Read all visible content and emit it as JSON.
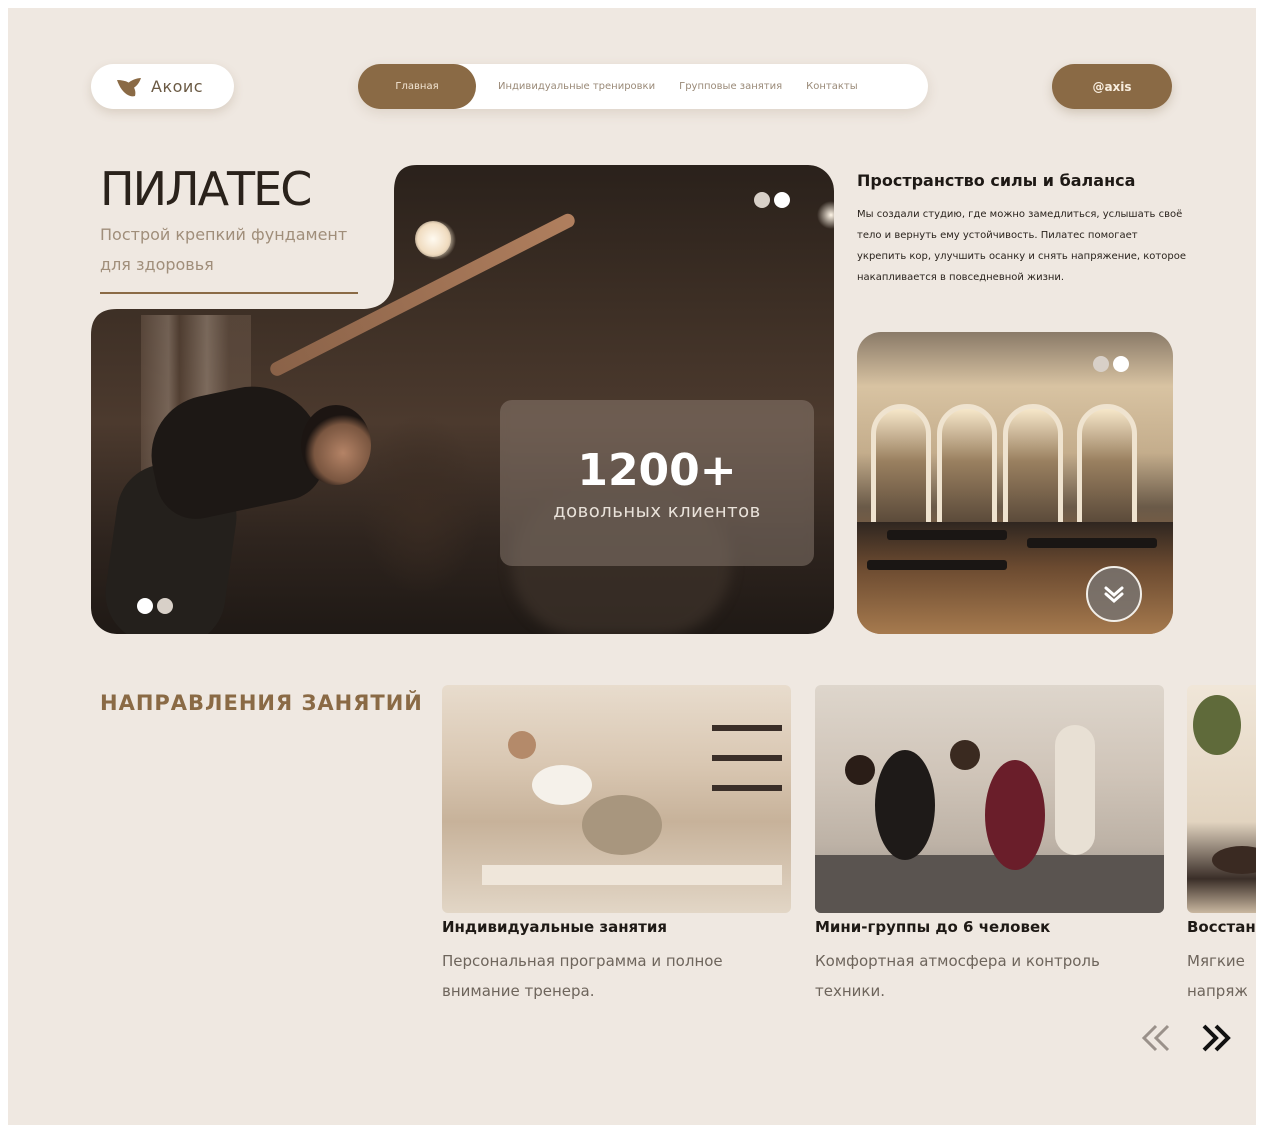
{
  "header": {
    "logo_text": "Акоис",
    "nav": [
      "Главная",
      "Индивидуальные тренировки",
      "Групповые занятия",
      "Контакты"
    ],
    "social_button": "@axis"
  },
  "hero": {
    "title": "ПИЛАТЕС",
    "subtitle": "Построй крепкий фундамент для здоровья",
    "stats_number": "1200+",
    "stats_label": "довольных клиентов"
  },
  "about": {
    "title": "Пространство силы и баланса",
    "text": "Мы создали студию, где можно замедлиться, услышать своё тело и вернуть ему устойчивость. Пилатес помогает укрепить кор, улучшить осанку и снять напряжение, которое накапливается в повседневной жизни."
  },
  "directions": {
    "title": "НАПРАВЛЕНИЯ ЗАНЯТИЙ",
    "cards": [
      {
        "title": "Индивидуальные занятия",
        "text": "Персональная программа и полное внимание тренера."
      },
      {
        "title": "Мини-группы до 6 человек",
        "text": "Комфортная атмосфера и контроль техники."
      },
      {
        "title": "Восстан",
        "text": "Мягкие напряже"
      }
    ]
  },
  "colors": {
    "accent": "#8a6a45",
    "background": "#efe8e1"
  },
  "icons": {
    "logo": "leaf-icon",
    "scroll_down": "chevron-down-icon",
    "prev": "double-chevron-left-icon",
    "next": "double-chevron-right-icon"
  }
}
